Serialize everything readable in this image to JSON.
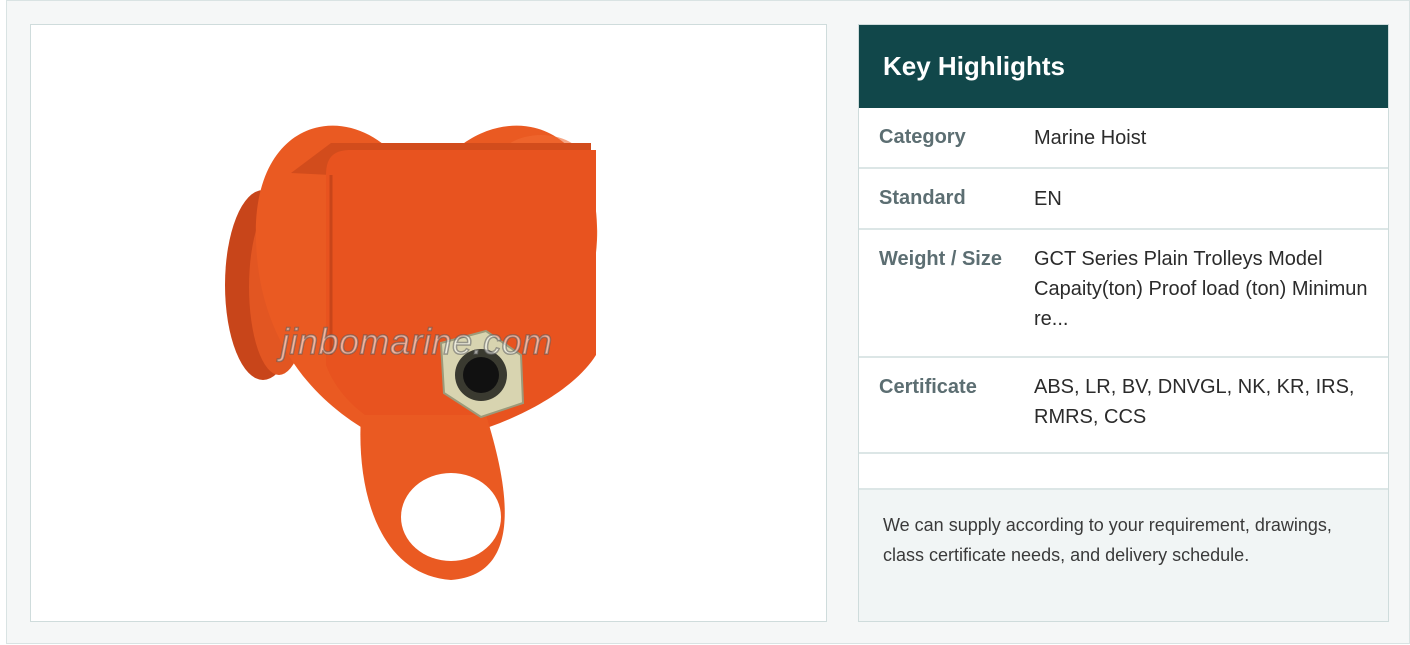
{
  "product": {
    "watermark": "jinbomarine.com"
  },
  "highlights": {
    "title": "Key Highlights",
    "rows": [
      {
        "key": "Category",
        "value": "Marine Hoist"
      },
      {
        "key": "Standard",
        "value": "EN"
      },
      {
        "key": "Weight / Size",
        "value": "GCT Series Plain Trolleys Model Capaity(ton) Proof load (ton) Minimun re..."
      },
      {
        "key": "Certificate",
        "value": "ABS, LR, BV, DNVGL, NK, KR, IRS, RMRS, CCS"
      },
      {
        "key": "",
        "value": ""
      }
    ],
    "note": "We can supply according to your requirement, drawings, class certificate needs, and delivery schedule."
  },
  "colors": {
    "header_bg": "#11474a",
    "trolley_orange": "#ea5a22"
  }
}
